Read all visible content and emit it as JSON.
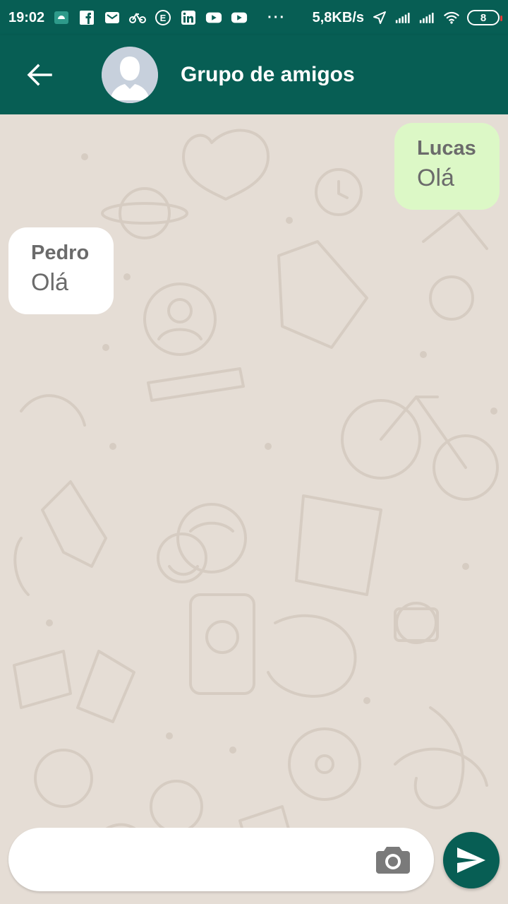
{
  "status_bar": {
    "time": "19:02",
    "network_speed": "5,8KB/s",
    "battery": "8",
    "dots": "···",
    "icons": [
      "android-debug-icon",
      "facebook-icon",
      "mail-icon",
      "bike-icon",
      "e-app-icon",
      "linkedin-icon",
      "youtube-icon",
      "youtube-icon",
      "location-arrow-icon",
      "signal-icon",
      "signal-icon",
      "wifi-icon",
      "battery-icon"
    ]
  },
  "header": {
    "title": "Grupo de amigos",
    "back_icon": "arrow-left-icon",
    "avatar_icon": "default-avatar-icon"
  },
  "messages": [
    {
      "sender": "Lucas",
      "text": "Olá",
      "direction": "outgoing"
    },
    {
      "sender": "Pedro",
      "text": "Olá",
      "direction": "incoming"
    }
  ],
  "composer": {
    "placeholder": "",
    "value": "",
    "camera_icon": "camera-icon",
    "send_icon": "send-icon"
  },
  "colors": {
    "primary": "#075e54",
    "chat_background": "#e5ddd5",
    "outgoing_bubble": "#dcf8c6",
    "incoming_bubble": "#ffffff"
  }
}
